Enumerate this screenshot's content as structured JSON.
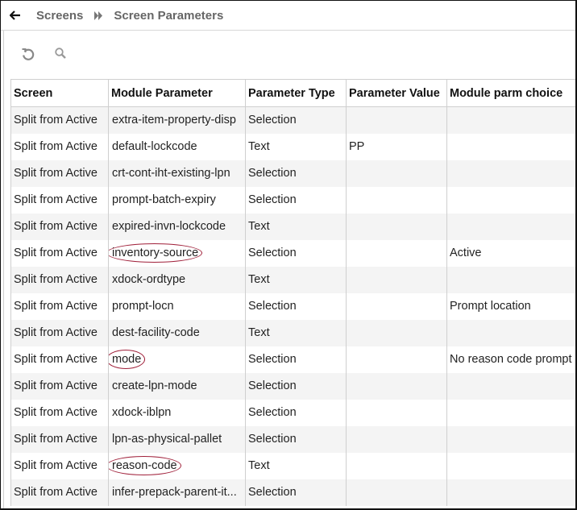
{
  "header": {
    "breadcrumb": [
      "Screens",
      "Screen Parameters"
    ],
    "back_icon": "arrow-left-icon",
    "separator_icon": "double-chevron-right-icon"
  },
  "toolbar": {
    "refresh_icon": "refresh-icon",
    "search_icon": "search-icon"
  },
  "table": {
    "columns": [
      "Screen",
      "Module Parameter",
      "Parameter Type",
      "Parameter Value",
      "Module parm choice"
    ],
    "rows": [
      {
        "screen": "Split from Active",
        "module_parameter": "extra-item-property-disp",
        "parameter_type": "Selection",
        "parameter_value": "",
        "module_parm_choice": "",
        "circled": false
      },
      {
        "screen": "Split from Active",
        "module_parameter": "default-lockcode",
        "parameter_type": "Text",
        "parameter_value": "PP",
        "module_parm_choice": "",
        "circled": false
      },
      {
        "screen": "Split from Active",
        "module_parameter": "crt-cont-iht-existing-lpn",
        "parameter_type": "Selection",
        "parameter_value": "",
        "module_parm_choice": "",
        "circled": false
      },
      {
        "screen": "Split from Active",
        "module_parameter": "prompt-batch-expiry",
        "parameter_type": "Selection",
        "parameter_value": "",
        "module_parm_choice": "",
        "circled": false
      },
      {
        "screen": "Split from Active",
        "module_parameter": "expired-invn-lockcode",
        "parameter_type": "Text",
        "parameter_value": "",
        "module_parm_choice": "",
        "circled": false
      },
      {
        "screen": "Split from Active",
        "module_parameter": "inventory-source",
        "parameter_type": "Selection",
        "parameter_value": "",
        "module_parm_choice": "Active",
        "circled": true
      },
      {
        "screen": "Split from Active",
        "module_parameter": "xdock-ordtype",
        "parameter_type": "Text",
        "parameter_value": "",
        "module_parm_choice": "",
        "circled": false
      },
      {
        "screen": "Split from Active",
        "module_parameter": "prompt-locn",
        "parameter_type": "Selection",
        "parameter_value": "",
        "module_parm_choice": "Prompt location",
        "circled": false
      },
      {
        "screen": "Split from Active",
        "module_parameter": "dest-facility-code",
        "parameter_type": "Text",
        "parameter_value": "",
        "module_parm_choice": "",
        "circled": false
      },
      {
        "screen": "Split from Active",
        "module_parameter": "mode",
        "parameter_type": "Selection",
        "parameter_value": "",
        "module_parm_choice": "No reason code prompt",
        "circled": true
      },
      {
        "screen": "Split from Active",
        "module_parameter": "create-lpn-mode",
        "parameter_type": "Selection",
        "parameter_value": "",
        "module_parm_choice": "",
        "circled": false
      },
      {
        "screen": "Split from Active",
        "module_parameter": "xdock-iblpn",
        "parameter_type": "Selection",
        "parameter_value": "",
        "module_parm_choice": "",
        "circled": false
      },
      {
        "screen": "Split from Active",
        "module_parameter": "lpn-as-physical-pallet",
        "parameter_type": "Selection",
        "parameter_value": "",
        "module_parm_choice": "",
        "circled": false
      },
      {
        "screen": "Split from Active",
        "module_parameter": "reason-code",
        "parameter_type": "Text",
        "parameter_value": "",
        "module_parm_choice": "",
        "circled": true
      },
      {
        "screen": "Split from Active",
        "module_parameter": "infer-prepack-parent-it...",
        "parameter_type": "Selection",
        "parameter_value": "",
        "module_parm_choice": "",
        "circled": false
      }
    ]
  },
  "colors": {
    "annotation_circle": "#a0203a",
    "stripe": "#f4f4f4",
    "breadcrumb_text": "#666666"
  }
}
